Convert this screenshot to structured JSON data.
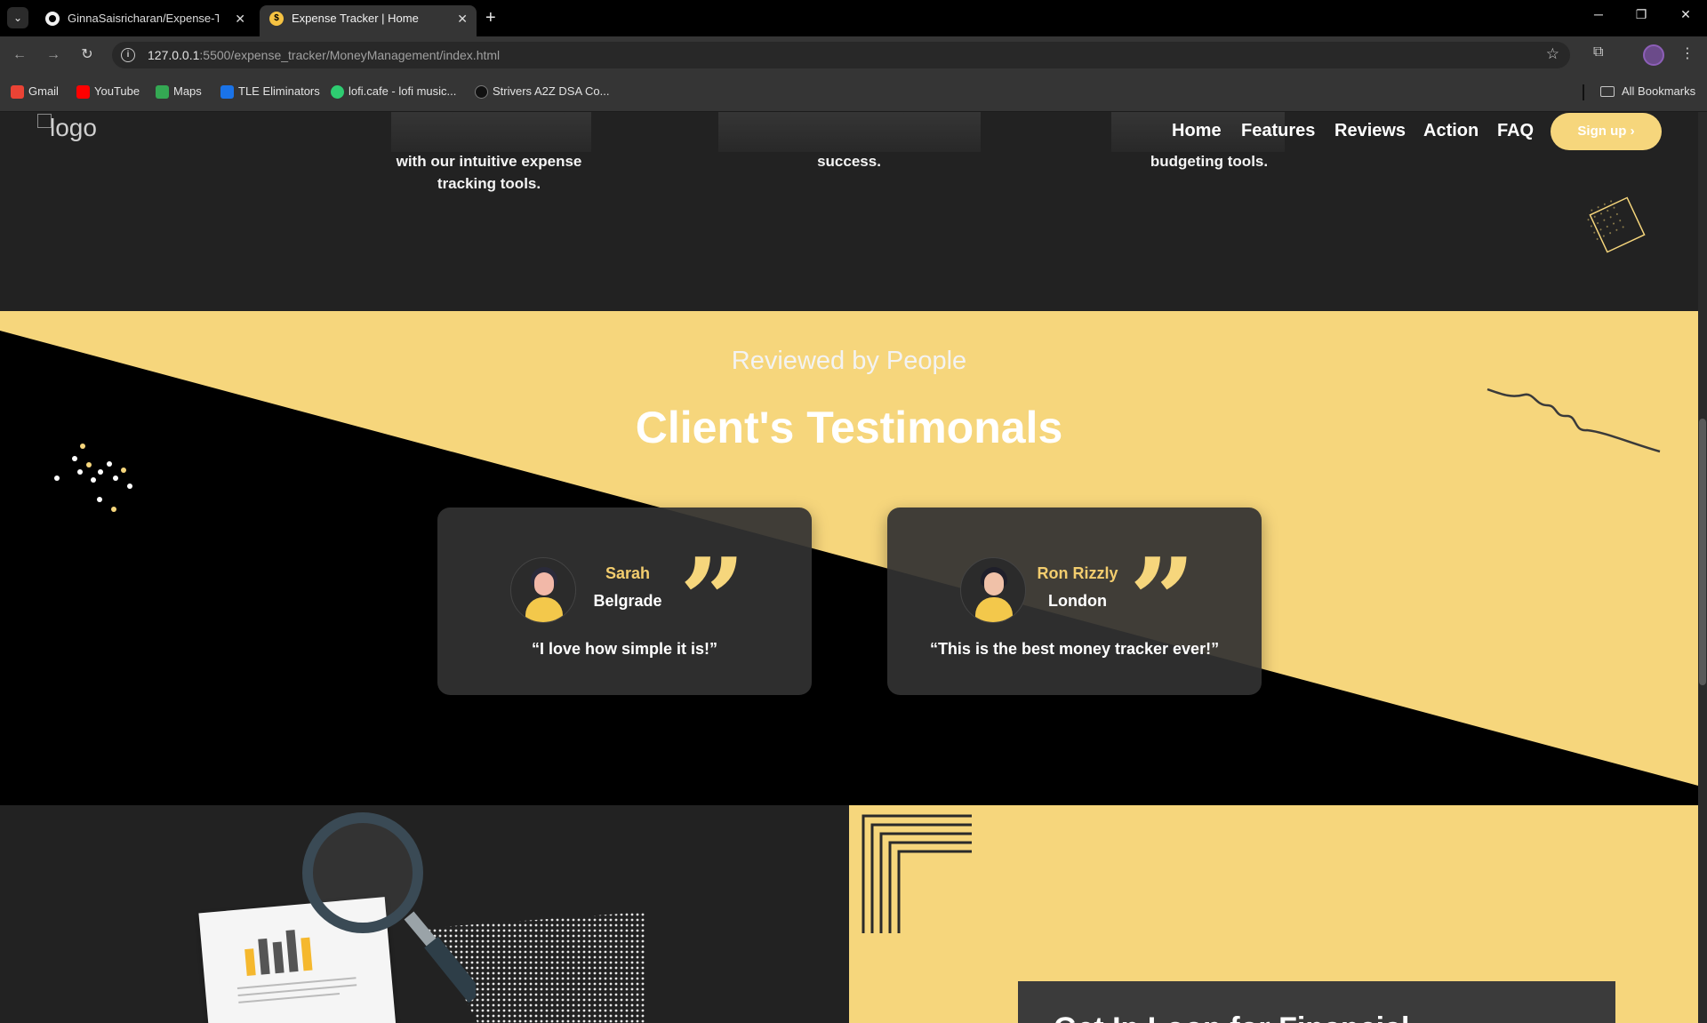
{
  "browser": {
    "tabs": [
      {
        "title": "GinnaSaisricharan/Expense-Tra",
        "active": false
      },
      {
        "title": "Expense Tracker | Home",
        "active": true
      }
    ],
    "url_host": "127.0.0.1",
    "url_path": ":5500/expense_tracker/MoneyManagement/index.html",
    "bookmarks": [
      {
        "label": "Gmail",
        "color": "#ea4335"
      },
      {
        "label": "YouTube",
        "color": "#ff0000"
      },
      {
        "label": "Maps",
        "color": "#34a853"
      },
      {
        "label": "TLE Eliminators",
        "color": "#1a73e8"
      },
      {
        "label": "lofi.cafe - lofi music...",
        "color": "#2ecc71"
      },
      {
        "label": "Strivers A2Z DSA Co...",
        "color": "#111111"
      }
    ],
    "all_bookmarks": "All Bookmarks"
  },
  "site": {
    "logo_alt": "logo",
    "nav": {
      "home": "Home",
      "features": "Features",
      "reviews": "Reviews",
      "action": "Action",
      "faq": "FAQ",
      "signup": "Sign up"
    },
    "features": [
      {
        "text": "with our intuitive expense tracking tools."
      },
      {
        "text": "success."
      },
      {
        "text": "budgeting tools."
      }
    ],
    "testimonials": {
      "subtitle": "Reviewed by People",
      "title": "Client's Testimonals",
      "items": [
        {
          "name": "Sarah",
          "city": "Belgrade",
          "quote": "“I love how simple it is!”"
        },
        {
          "name": "Ron Rizzly",
          "city": "London",
          "quote": "“This is the best money tracker ever!”"
        }
      ]
    },
    "action": {
      "title": "Get In Loop for Financial"
    },
    "colors": {
      "accent": "#f6d67c",
      "dark": "#222222",
      "black": "#000000"
    }
  }
}
